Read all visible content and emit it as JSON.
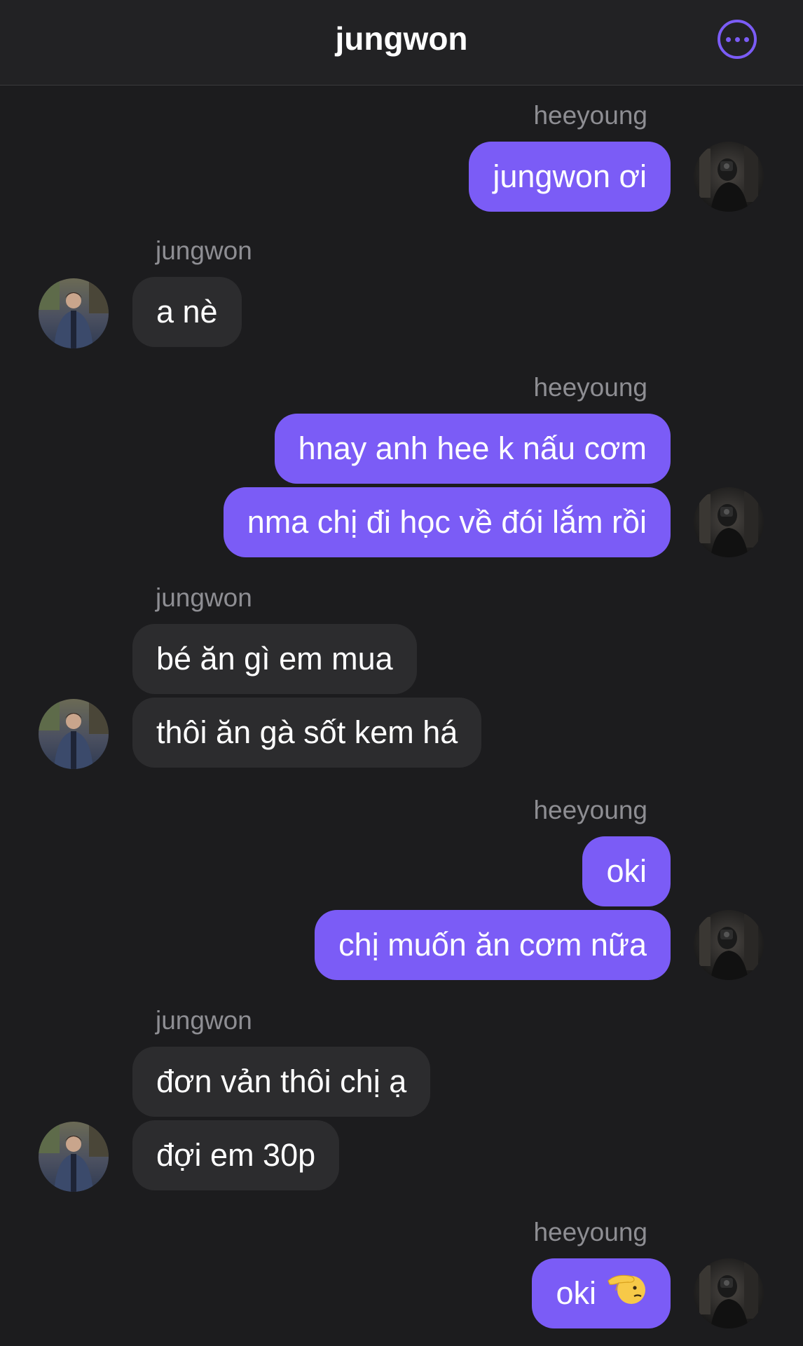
{
  "header": {
    "title": "jungwon",
    "more_icon": "more-horizontal-icon"
  },
  "colors": {
    "accent": "#7b5cf6",
    "incoming_bubble": "#2c2c2e",
    "background": "#1c1c1e"
  },
  "messages": [
    {
      "sender": "heeyoung",
      "side": "right",
      "bubbles": [
        "jungwon ơi"
      ]
    },
    {
      "sender": "jungwon",
      "side": "left",
      "bubbles": [
        "a nè"
      ]
    },
    {
      "sender": "heeyoung",
      "side": "right",
      "bubbles": [
        "hnay anh hee k nấu cơm",
        "nma chị đi học về đói lắm rồi"
      ]
    },
    {
      "sender": "jungwon",
      "side": "left",
      "bubbles": [
        "bé ăn gì em mua",
        "thôi ăn gà sốt kem há"
      ]
    },
    {
      "sender": "heeyoung",
      "side": "right",
      "bubbles": [
        "oki",
        "chị muốn ăn cơm nữa"
      ]
    },
    {
      "sender": "jungwon",
      "side": "left",
      "bubbles": [
        "đơn vản thôi chị ạ",
        "đợi em 30p"
      ]
    },
    {
      "sender": "heeyoung",
      "side": "right",
      "bubbles": [
        "oki"
      ],
      "emoji": "saluting-face-emoji"
    }
  ]
}
